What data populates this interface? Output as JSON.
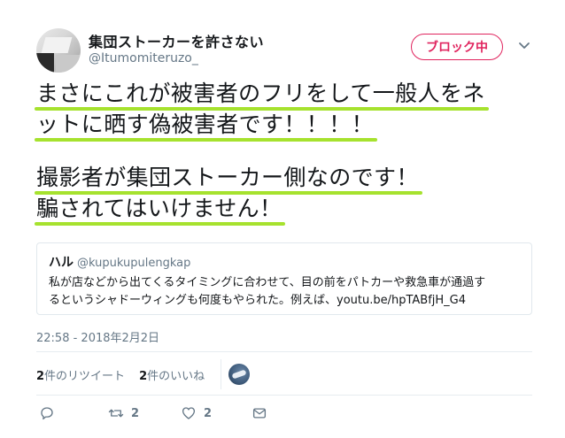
{
  "user": {
    "name": "集団ストーカーを許さない",
    "handle": "@Itumomiteruzo_"
  },
  "block_button": {
    "label": "ブロック中"
  },
  "tweet": {
    "lines": [
      "まさにこれが被害者のフリをして一般人をネ",
      "ットに晒す偽被害者です！！！！",
      "撮影者が集団ストーカー側なのです！",
      "騙されてはいけません！"
    ],
    "highlight_color": "#a6e22e"
  },
  "quote": {
    "name": "ハル",
    "handle": "@kupukupulengkap",
    "body_lines": [
      "私が店などから出てくるタイミングに合わせて、目の前をパトカーや救急車が通過す",
      "るというシャドーウィングも何度もやられた。例えば、youtu.be/hpTABfjH_G4"
    ]
  },
  "timestamp": "22:58 - 2018年2月2日",
  "stats": {
    "retweets_count": "2",
    "retweets_label": "件のリツイート",
    "likes_count": "2",
    "likes_label": "件のいいね"
  },
  "actions": {
    "reply_icon": "reply-icon",
    "retweet_icon": "retweet-icon",
    "retweet_count": "2",
    "like_icon": "heart-icon",
    "like_count": "2",
    "message_icon": "mail-icon"
  },
  "colors": {
    "block_red": "#e0245e",
    "secondary_text": "#657786",
    "border": "#e1e8ed"
  }
}
